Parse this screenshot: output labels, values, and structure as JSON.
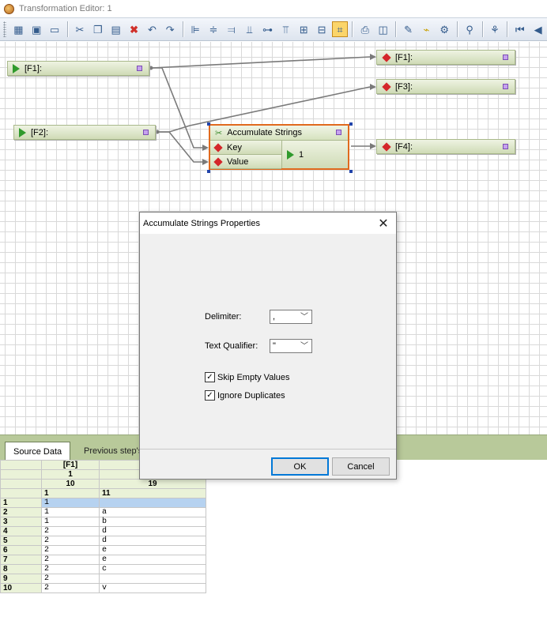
{
  "window": {
    "title": "Transformation Editor: 1"
  },
  "toolbar": {
    "icons": [
      "properties-icon",
      "save-icon",
      "config-icon",
      "cut-icon",
      "copy-icon",
      "paste-icon",
      "delete-icon",
      "undo-icon",
      "redo-icon",
      "align-left-icon",
      "align-center-icon",
      "align-right-icon",
      "align-bottom-icon",
      "align-middle-icon",
      "align-top-icon",
      "distribute-h-icon",
      "distribute-v-icon",
      "grid-icon",
      "print-icon",
      "preview-icon",
      "new-field-icon",
      "clean-icon",
      "map-icon",
      "find-icon",
      "run-icon",
      "first-icon",
      "prev-icon"
    ]
  },
  "canvas": {
    "source_fields": [
      "[F1]:",
      "[F2]:"
    ],
    "target_fields": [
      "[F1]:",
      "[F3]:",
      "[F4]:"
    ],
    "node": {
      "title": "Accumulate Strings",
      "inputs": [
        "Key",
        "Value"
      ],
      "output": "1"
    }
  },
  "bottom": {
    "tabs": [
      "Source Data",
      "Previous step's"
    ],
    "header_rows": [
      [
        "",
        "[F1]",
        ""
      ],
      [
        "",
        "1",
        ""
      ],
      [
        "",
        "10",
        "19"
      ],
      [
        "",
        "1",
        "11"
      ]
    ],
    "rows": [
      {
        "n": "1",
        "a": "1",
        "b": ""
      },
      {
        "n": "2",
        "a": "1",
        "b": "a"
      },
      {
        "n": "3",
        "a": "1",
        "b": "b"
      },
      {
        "n": "4",
        "a": "2",
        "b": "d"
      },
      {
        "n": "5",
        "a": "2",
        "b": "d"
      },
      {
        "n": "6",
        "a": "2",
        "b": "e"
      },
      {
        "n": "7",
        "a": "2",
        "b": "e"
      },
      {
        "n": "8",
        "a": "2",
        "b": "c"
      },
      {
        "n": "9",
        "a": "2",
        "b": ""
      },
      {
        "n": "10",
        "a": "2",
        "b": "v"
      }
    ]
  },
  "dialog": {
    "title": "Accumulate Strings Properties",
    "close": "✕",
    "delimiter_label": "Delimiter:",
    "delimiter_value": ",",
    "qualifier_label": "Text Qualifier:",
    "qualifier_value": "\"",
    "skip_empty_label": "Skip Empty Values",
    "skip_empty_checked": true,
    "ignore_dup_label": "Ignore Duplicates",
    "ignore_dup_checked": true,
    "ok_label": "OK",
    "cancel_label": "Cancel"
  }
}
